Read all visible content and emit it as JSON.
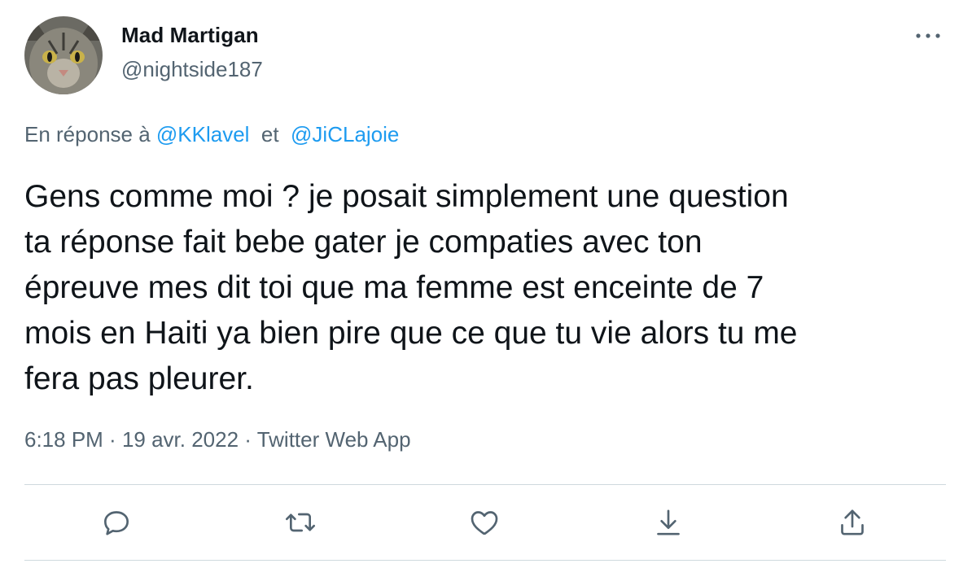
{
  "author": {
    "display_name": "Mad Martigan",
    "handle": "@nightside187"
  },
  "reply_to": {
    "prefix": "En réponse à ",
    "mention_1": "@KKlavel",
    "conjunction": "  et  ",
    "mention_2": "@JiCLajoie"
  },
  "tweet": {
    "text": "Gens comme moi ? je posait simplement une question\nta réponse fait bebe gater je compaties avec ton\népreuve mes dit toi que ma femme est enceinte de 7\nmois en Haiti ya bien pire que ce que tu vie alors tu me\nfera pas pleurer."
  },
  "meta": {
    "time": "6:18 PM",
    "separator": " · ",
    "date": "19 avr. 2022",
    "source": "Twitter Web App"
  },
  "actions": {
    "icons": [
      "reply-icon",
      "retweet-icon",
      "like-icon",
      "bookmark-icon",
      "share-icon"
    ]
  },
  "colors": {
    "text": "#0f1419",
    "secondary": "#536471",
    "accent": "#1d9bf0",
    "divider": "#cfd9de"
  }
}
